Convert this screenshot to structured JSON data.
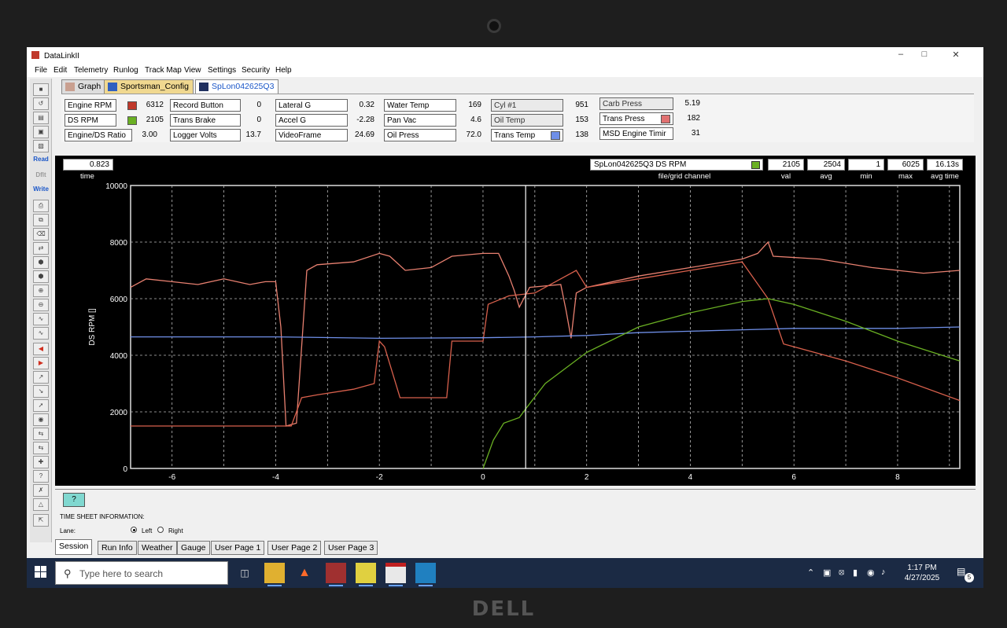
{
  "window": {
    "title": "DataLinkII"
  },
  "menu": [
    "File",
    "Edit",
    "Telemetry",
    "Runlog",
    "Track Map",
    "View",
    "Settings",
    "Security",
    "Help"
  ],
  "toolbar": {
    "read": "Read",
    "dflt": "Dflt",
    "write": "Write"
  },
  "tabs": [
    {
      "label": "Graph"
    },
    {
      "label": "Sportsman_Config"
    },
    {
      "label": "SpLon042625Q3"
    }
  ],
  "channels": {
    "engine_rpm": {
      "label": "Engine RPM",
      "value": "6312",
      "color": "#c0392b"
    },
    "ds_rpm": {
      "label": "DS RPM",
      "value": "2105",
      "color": "#6ab023"
    },
    "engine_ds_ratio": {
      "label": "Engine/DS Ratio",
      "value": "3.00"
    },
    "record_button": {
      "label": "Record Button",
      "value": "0"
    },
    "trans_brake": {
      "label": "Trans Brake",
      "value": "0"
    },
    "logger_volts": {
      "label": "Logger Volts",
      "value": "13.7"
    },
    "lateral_g": {
      "label": "Lateral G",
      "value": "0.32"
    },
    "accel_g": {
      "label": "Accel G",
      "value": "-2.28"
    },
    "videoframe": {
      "label": "VideoFrame",
      "value": "24.69"
    },
    "water_temp": {
      "label": "Water Temp",
      "value": "169"
    },
    "pan_vac": {
      "label": "Pan Vac",
      "value": "4.6"
    },
    "oil_press": {
      "label": "Oil Press",
      "value": "72.0"
    },
    "cyl1": {
      "label": "Cyl #1",
      "value": "951"
    },
    "oil_temp": {
      "label": "Oil Temp",
      "value": "153"
    },
    "trans_temp": {
      "label": "Trans Temp",
      "value": "138",
      "color": "#6f8fe8"
    },
    "carb_press": {
      "label": "Carb Press",
      "value": "5.19"
    },
    "trans_press": {
      "label": "Trans Press",
      "value": "182",
      "color": "#e07070"
    },
    "msd_timing": {
      "label": "MSD Engine Timir",
      "value": "31"
    }
  },
  "readout": {
    "time_value": "0.823",
    "time_label": "time",
    "file_channel": "SpLon042625Q3     DS RPM",
    "file_channel_color": "#6ab023",
    "file_channel_label": "file/grid channel",
    "val": "2105",
    "val_label": "val",
    "avg": "2504",
    "avg_label": "avg",
    "min": "1",
    "min_label": "min",
    "max": "6025",
    "max_label": "max",
    "avg_time": "16.13s",
    "avg_time_label": "avg time"
  },
  "chart_data": {
    "type": "line",
    "ylabel": "DS RPM []",
    "xlim": [
      -6.8,
      9.2
    ],
    "ylim": [
      0,
      10000
    ],
    "x_ticks": [
      "-6",
      "-4",
      "-2",
      "0",
      "2",
      "4",
      "6",
      "8"
    ],
    "y_ticks": [
      "0",
      "2000",
      "4000",
      "6000",
      "8000",
      "10000"
    ],
    "cursor_x": 0.823,
    "grid": true,
    "series": [
      {
        "name": "Engine RPM",
        "color": "#e88070",
        "points": [
          [
            -6.8,
            6400
          ],
          [
            -6.5,
            6700
          ],
          [
            -6,
            6600
          ],
          [
            -5.5,
            6500
          ],
          [
            -5,
            6700
          ],
          [
            -4.5,
            6500
          ],
          [
            -4.2,
            6600
          ],
          [
            -4,
            6600
          ],
          [
            -3.9,
            5000
          ],
          [
            -3.8,
            1500
          ],
          [
            -3.6,
            1600
          ],
          [
            -3.4,
            7000
          ],
          [
            -3.2,
            7200
          ],
          [
            -2.5,
            7300
          ],
          [
            -2,
            7600
          ],
          [
            -1.8,
            7500
          ],
          [
            -1.5,
            7000
          ],
          [
            -1,
            7100
          ],
          [
            -0.6,
            7500
          ],
          [
            0,
            7600
          ],
          [
            0.3,
            7600
          ],
          [
            0.5,
            6800
          ],
          [
            0.6,
            6300
          ],
          [
            0.7,
            5700
          ],
          [
            0.9,
            6400
          ],
          [
            1.5,
            6500
          ],
          [
            1.6,
            5600
          ],
          [
            1.7,
            4600
          ],
          [
            1.8,
            6200
          ],
          [
            2,
            6400
          ],
          [
            3,
            6800
          ],
          [
            4,
            7100
          ],
          [
            5,
            7400
          ],
          [
            5.3,
            7600
          ],
          [
            5.5,
            8000
          ],
          [
            5.6,
            7500
          ],
          [
            6.5,
            7400
          ],
          [
            7.5,
            7100
          ],
          [
            8.5,
            6900
          ],
          [
            9.2,
            7000
          ]
        ]
      },
      {
        "name": "Trans Press",
        "color": "#d8604c",
        "points": [
          [
            -6.8,
            1500
          ],
          [
            -4,
            1500
          ],
          [
            -3.7,
            1500
          ],
          [
            -3.5,
            2500
          ],
          [
            -3.2,
            2600
          ],
          [
            -2.5,
            2800
          ],
          [
            -2.1,
            3000
          ],
          [
            -2,
            4500
          ],
          [
            -1.9,
            4300
          ],
          [
            -1.6,
            2500
          ],
          [
            -1,
            2500
          ],
          [
            -0.7,
            2500
          ],
          [
            -0.6,
            4500
          ],
          [
            0,
            4500
          ],
          [
            0.1,
            5800
          ],
          [
            0.5,
            6100
          ],
          [
            1,
            6200
          ],
          [
            1.8,
            7000
          ],
          [
            2,
            6400
          ],
          [
            3,
            6700
          ],
          [
            4,
            7000
          ],
          [
            5,
            7300
          ],
          [
            5.5,
            6000
          ],
          [
            5.8,
            4400
          ],
          [
            7,
            3800
          ],
          [
            8,
            3200
          ],
          [
            9.2,
            2400
          ]
        ]
      },
      {
        "name": "Trans Temp",
        "color": "#6f8fe8",
        "points": [
          [
            -6.8,
            4650
          ],
          [
            -4,
            4650
          ],
          [
            -2,
            4600
          ],
          [
            0,
            4620
          ],
          [
            1,
            4650
          ],
          [
            2,
            4700
          ],
          [
            3,
            4800
          ],
          [
            4,
            4850
          ],
          [
            5,
            4900
          ],
          [
            6,
            4950
          ],
          [
            7,
            4950
          ],
          [
            8,
            4950
          ],
          [
            9.2,
            5000
          ]
        ]
      },
      {
        "name": "DS RPM",
        "color": "#6ab023",
        "points": [
          [
            0,
            0
          ],
          [
            0.2,
            1000
          ],
          [
            0.4,
            1600
          ],
          [
            0.7,
            1800
          ],
          [
            0.823,
            2105
          ],
          [
            1.2,
            3000
          ],
          [
            2,
            4100
          ],
          [
            3,
            5000
          ],
          [
            4,
            5500
          ],
          [
            5,
            5900
          ],
          [
            5.5,
            6000
          ],
          [
            6,
            5800
          ],
          [
            7,
            5200
          ],
          [
            8,
            4500
          ],
          [
            9.2,
            3800
          ]
        ]
      }
    ]
  },
  "bottom": {
    "help": "?",
    "time_sheet": "TIME SHEET INFORMATION:",
    "lane": "Lane:",
    "left": "Left",
    "right": "Right"
  },
  "bottom_tabs": [
    "Session",
    "Run Info",
    "Weather",
    "Gauge",
    "User Page 1",
    "User Page 2",
    "User Page 3"
  ],
  "taskbar": {
    "search_placeholder": "Type here to search",
    "time": "1:17 PM",
    "date": "4/27/2025",
    "notifications": "5"
  },
  "bezel": {
    "brand": "DELL"
  }
}
